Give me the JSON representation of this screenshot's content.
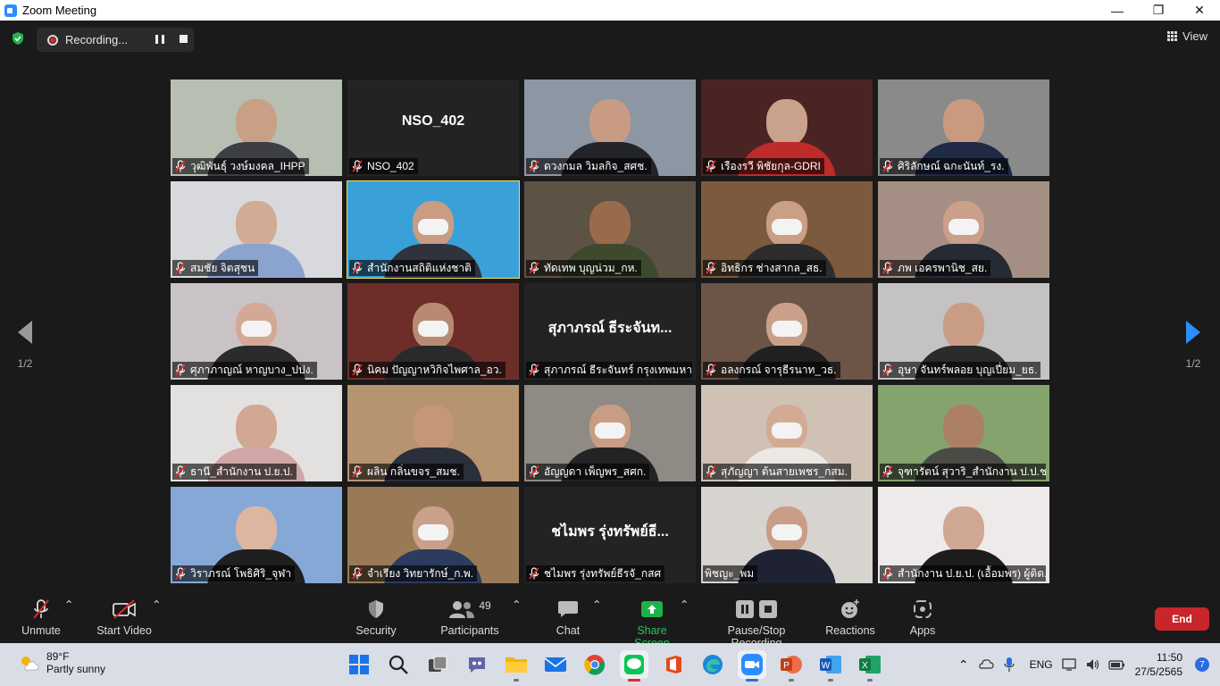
{
  "window": {
    "title": "Zoom Meeting"
  },
  "recording": {
    "label": "Recording..."
  },
  "view": {
    "label": "View"
  },
  "pagination": {
    "left": "1/2",
    "right": "1/2"
  },
  "participants": [
    {
      "name": "วุฒิพันธุ์ วงษ์มงคล_IHPP",
      "bg": "#b7bfb3",
      "skin": "#c99f86",
      "shirt": "#3e3f44",
      "masked": false
    },
    {
      "name": "NSO_402",
      "bigname": "NSO_402",
      "video": false
    },
    {
      "name": "ดวงกมล วิมลกิจ_สศช.",
      "bg": "#8d97a3",
      "skin": "#c89b82",
      "shirt": "#23232a",
      "masked": false
    },
    {
      "name": "เรืองรวี พิชัยกุล-GDRI",
      "bg": "#4a2323",
      "skin": "#caa18c",
      "shirt": "#bf2b2b",
      "masked": false
    },
    {
      "name": "ศิริลักษณ์ ฉกะนันท์_รง.",
      "bg": "#8a8a8a",
      "skin": "#c89a7e",
      "shirt": "#1f2a44",
      "masked": false
    },
    {
      "name": "สมชัย จิตสุชน",
      "bg": "#d7d9dc",
      "skin": "#d1ab93",
      "shirt": "#8ba4cf",
      "masked": false
    },
    {
      "name": "สำนักงานสถิติแห่งชาติ",
      "bg": "#3aa0d8",
      "skin": "#c99d84",
      "shirt": "#30323c",
      "masked": true,
      "active": true
    },
    {
      "name": "ทัดเทพ บุญน่วม_กห.",
      "bg": "#5c5345",
      "skin": "#9a6a4c",
      "shirt": "#3f4a2c",
      "masked": false
    },
    {
      "name": "อิทธิกร ช่างสากล_สธ.",
      "bg": "#7b5a3e",
      "skin": "#c9a085",
      "shirt": "#2d2d2d",
      "masked": true
    },
    {
      "name": "ภพ เอครพานิช_สย.",
      "bg": "#a58f84",
      "skin": "#caa08a",
      "shirt": "#262a33",
      "masked": true
    },
    {
      "name": "ศุภาภาญณ์ หาญบาง_ปปง.",
      "bg": "#c9c3c5",
      "skin": "#d3a996",
      "shirt": "#2b2b2b",
      "masked": true
    },
    {
      "name": "นิคม ปัญญาหวิกิจไพศาล_อว.",
      "bg": "#6d2e2a",
      "skin": "#b88a73",
      "shirt": "#2a2a2a",
      "masked": true
    },
    {
      "name": "สุภาภรณ์ ธีระจันทร์ กรุงเทพมหานคร",
      "bigname": "สุภาภรณ์ ธีระจันท...",
      "video": false
    },
    {
      "name": "อลงกรณ์ จารุธีรนาท_วธ.",
      "bg": "#6c5447",
      "skin": "#caa08a",
      "shirt": "#202020",
      "masked": true
    },
    {
      "name": "อุษา จันทร์พลอย บุญเปี่ยม_ยธ.",
      "bg": "#c4c2c3",
      "skin": "#c99d85",
      "shirt": "#2b2b2b",
      "masked": false
    },
    {
      "name": "ธานี_สำนักงาน ป.ย.ป.",
      "bg": "#e3e1e0",
      "skin": "#d1a793",
      "shirt": "#d1a6a6",
      "masked": false
    },
    {
      "name": "ผลิน กลิ่นขจร_สมช.",
      "bg": "#b69470",
      "skin": "#c49779",
      "shirt": "#2a2f3a",
      "masked": false
    },
    {
      "name": "อัญญดา เพ็ญพร_สศก.",
      "bg": "#8f8a84",
      "skin": "#c99d84",
      "shirt": "#232323",
      "masked": true
    },
    {
      "name": "สุภัญญา ต้นสายเพชร_กสม.",
      "bg": "#cfc2b5",
      "skin": "#d3ab95",
      "shirt": "#ece8e4",
      "masked": true
    },
    {
      "name": "จุฑารัตน์ สุวาริ_สำนักงาน ป.ป.ช.",
      "bg": "#85a36d",
      "skin": "#ad7f63",
      "shirt": "#4b4b45",
      "masked": false
    },
    {
      "name": "วิราภรณ์ โพธิศิริ_จุฬา",
      "bg": "#86a8d6",
      "skin": "#ddb6a0",
      "shirt": "#1f1f1f",
      "masked": false
    },
    {
      "name": "จำเรียง วิทยารักษ์_ก.พ.",
      "bg": "#9a7a56",
      "skin": "#caa08a",
      "shirt": "#2b3c5e",
      "masked": true
    },
    {
      "name": "ชไมพร รุ่งทรัพย์ธีรจันทร์_กสศ",
      "bigname": "ชไมพร รุ่งทรัพย์ธี...",
      "video": false,
      "label": "ชไมพร รุ่งทรัพย์ธีรจั_กสศ"
    },
    {
      "name": "พิชญะ_พม",
      "bg": "#d7d4cf",
      "skin": "#c89e86",
      "shirt": "#1f2233",
      "masked": true,
      "noMic": true
    },
    {
      "name": "สำนักงาน ป.ย.ป. (เอื้อมพร) ผู้ติด...",
      "bg": "#efeaea",
      "skin": "#d0a792",
      "shirt": "#1c1c1c",
      "masked": false
    }
  ],
  "toolbar": {
    "unmute": "Unmute",
    "start_video": "Start Video",
    "security": "Security",
    "participants": "Participants",
    "participants_count": "49",
    "chat": "Chat",
    "share_screen": "Share Screen",
    "pause_stop": "Pause/Stop Recording",
    "reactions": "Reactions",
    "apps": "Apps",
    "end": "End"
  },
  "taskbar": {
    "temp": "89°F",
    "weather": "Partly sunny",
    "lang": "ENG",
    "time": "11:50",
    "date": "27/5/2565",
    "notifications": "7"
  },
  "colors": {
    "accent_green": "#28c45a",
    "end_red": "#c9252c",
    "active_border": "#e6e06a"
  }
}
